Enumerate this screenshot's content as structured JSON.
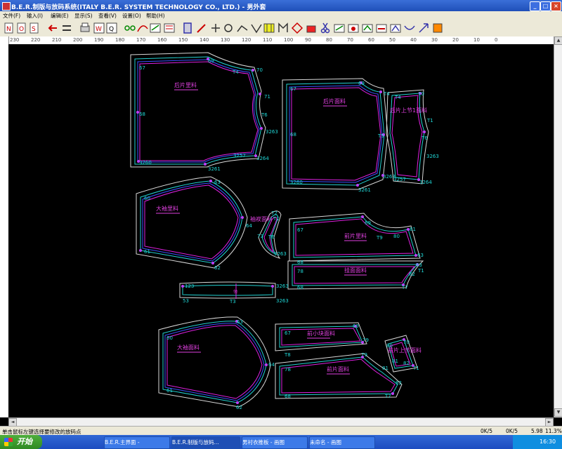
{
  "window": {
    "title": "B.E.R.制版与放码系统(ITALY B.E.R. SYSTEM TECHNOLOGY CO., LTD.) - 男外套",
    "controls": [
      "_",
      "□",
      "×"
    ]
  },
  "menu": [
    "文件(F)",
    "输入(I)",
    "编辑(E)",
    "显示(S)",
    "查看(V)",
    "设置(O)",
    "帮助(H)"
  ],
  "ruler": {
    "top_labels": [
      "230",
      "220",
      "210",
      "200",
      "190",
      "180",
      "170",
      "160",
      "150",
      "140",
      "130",
      "120",
      "110",
      "100",
      "90",
      "80",
      "70",
      "60",
      "50",
      "40",
      "30",
      "20",
      "10",
      "0"
    ]
  },
  "pieces": {
    "back_lining": "后片里料",
    "back_face": "后片面料",
    "back_yoke": "后片上节1面料",
    "sleeve_lining": "大袖里料",
    "cuff": "袖衩面料",
    "front_lining": "前片里料",
    "front_facing": "挂面面料",
    "collar": "领",
    "sleeve_face": "大袖面料",
    "front_small": "前小块面料",
    "front_yoke": "前片上节面料",
    "front_face": "前片面料"
  },
  "points": {
    "p67": "67",
    "p69": "69",
    "p70": "70",
    "p68": "68",
    "p71": "71",
    "pT4": "T4",
    "pT1": "T1",
    "pT6": "T6",
    "p3263": "3263",
    "p3264": "3264",
    "p3257": "3257",
    "p3260": "3260",
    "p3261": "3261",
    "pT5": "T5",
    "p60": "60",
    "p63": "63",
    "p61": "61",
    "p62": "62",
    "p64": "64",
    "p72": "72",
    "p73": "73",
    "pT9": "T9",
    "p80": "80",
    "p81": "81",
    "p79": "79",
    "p78": "78",
    "pT7": "T7",
    "pT8": "T8",
    "p123": "123",
    "p53": "53",
    "pT3": "T3",
    "p82": "82"
  },
  "status": {
    "hint": "单击鼠标左键选择要修改的放码点",
    "ok1": "0K/5",
    "ok2": "0K/5",
    "value": "5.98",
    "zoom": "11.3%"
  },
  "taskbar": {
    "start": "开始",
    "items": [
      "B.E.R.主界面 -",
      "B.E.R.制版与放码...",
      "男衬衣推板 - 画图",
      "未命名 - 画图"
    ],
    "clock": "16:30"
  },
  "colors": {
    "outline": "#d8d8d8",
    "grade_cyan": "#22d0d0",
    "grade_blue": "#3a50ff",
    "grade_magenta": "#e020e0",
    "label": "#e040e0",
    "point": "#20d8d8"
  }
}
